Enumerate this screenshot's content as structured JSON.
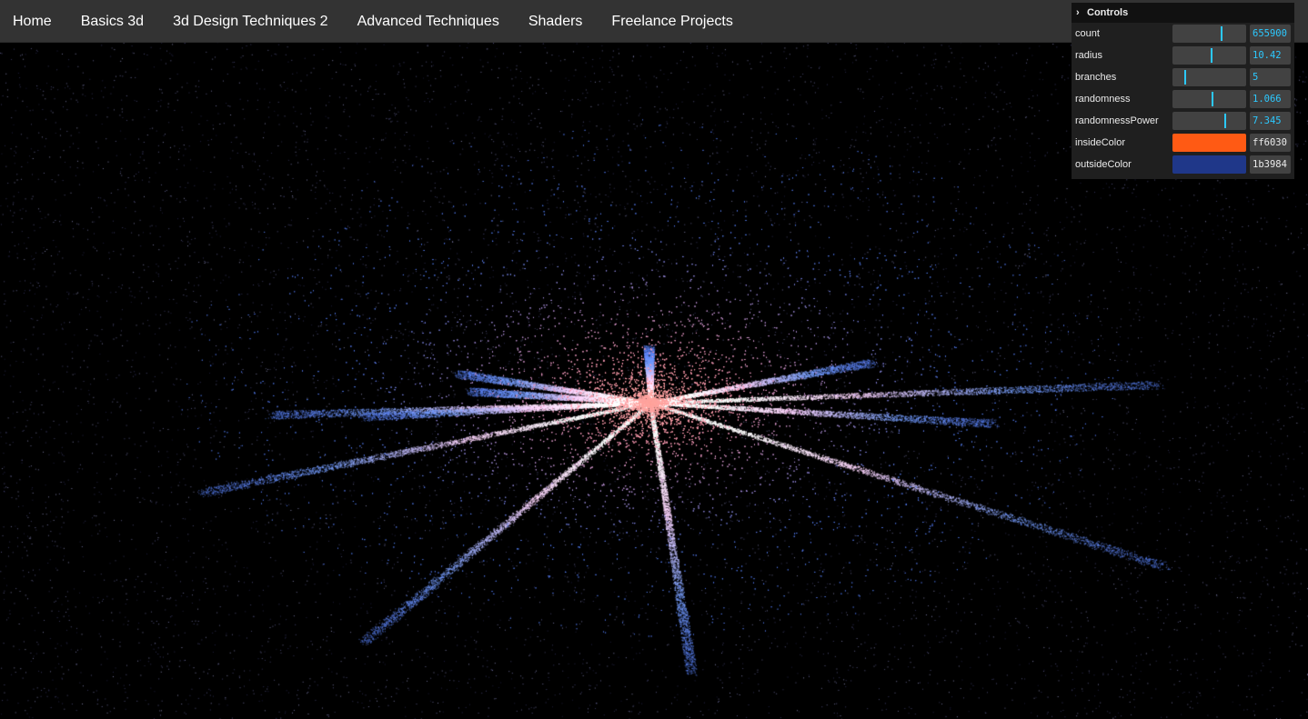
{
  "nav": {
    "links": [
      "Home",
      "Basics 3d",
      "3d Design Techniques 2",
      "Advanced Techniques",
      "Shaders",
      "Freelance Projects"
    ]
  },
  "controls": {
    "title": "Controls",
    "sliders": [
      {
        "label": "count",
        "value": "655900",
        "fraction": 0.65
      },
      {
        "label": "radius",
        "value": "10.42",
        "fraction": 0.52
      },
      {
        "label": "branches",
        "value": "5",
        "fraction": 0.16
      },
      {
        "label": "randomness",
        "value": "1.066",
        "fraction": 0.53
      },
      {
        "label": "randomnessPower",
        "value": "7.345",
        "fraction": 0.7
      }
    ],
    "colors": [
      {
        "label": "insideColor",
        "value": "ff6030",
        "color": "#ff5a14"
      },
      {
        "label": "outsideColor",
        "value": "1b3984",
        "color": "#1f3789"
      }
    ]
  },
  "theme": {
    "nav_bg": "#333333",
    "slider_accent": "#2cc9ff",
    "scene_bg": "#000000"
  }
}
